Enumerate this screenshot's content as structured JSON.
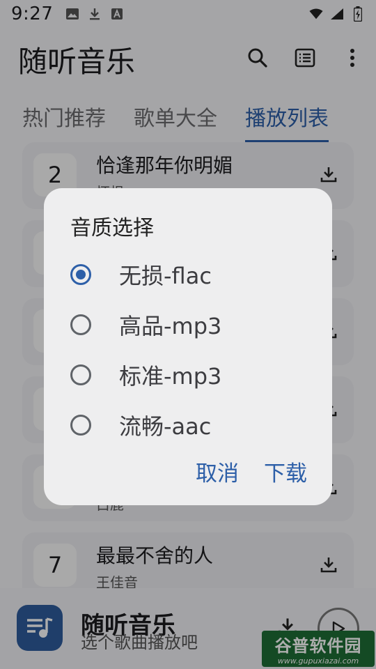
{
  "status_bar": {
    "time": "9:27",
    "left_icons": [
      "image-icon",
      "download-icon",
      "font-icon"
    ],
    "right_icons": [
      "wifi-icon",
      "signal-icon",
      "battery-icon"
    ]
  },
  "app_bar": {
    "title": "随听音乐",
    "actions": [
      "search-icon",
      "list-icon",
      "more-icon"
    ]
  },
  "tabs": [
    {
      "label": "热门推荐",
      "active": false
    },
    {
      "label": "歌单大全",
      "active": false
    },
    {
      "label": "播放列表",
      "active": true
    }
  ],
  "songs": [
    {
      "rank": "2",
      "title": "恰逢那年你明媚",
      "artist": "怀根"
    },
    {
      "rank": "",
      "title": "",
      "artist": ""
    },
    {
      "rank": "",
      "title": "",
      "artist": ""
    },
    {
      "rank": "",
      "title": "",
      "artist": ""
    },
    {
      "rank": "",
      "title": "",
      "artist": "白鹿"
    },
    {
      "rank": "7",
      "title": "最最不舍的人",
      "artist": "王佳音"
    }
  ],
  "player": {
    "title": "随听音乐",
    "subtitle": "选个歌曲播放吧"
  },
  "watermark": {
    "main": "谷普软件园",
    "url": "www.gupuxiazai.com"
  },
  "dialog": {
    "title": "音质选择",
    "options": [
      {
        "label": "无损-flac",
        "checked": true
      },
      {
        "label": "高品-mp3",
        "checked": false
      },
      {
        "label": "标准-mp3",
        "checked": false
      },
      {
        "label": "流畅-aac",
        "checked": false
      }
    ],
    "cancel_label": "取消",
    "confirm_label": "下载"
  },
  "colors": {
    "accent": "#2d5fa8",
    "scrim": "rgba(0,0,0,0.32)",
    "watermark": "#1e6e35"
  }
}
